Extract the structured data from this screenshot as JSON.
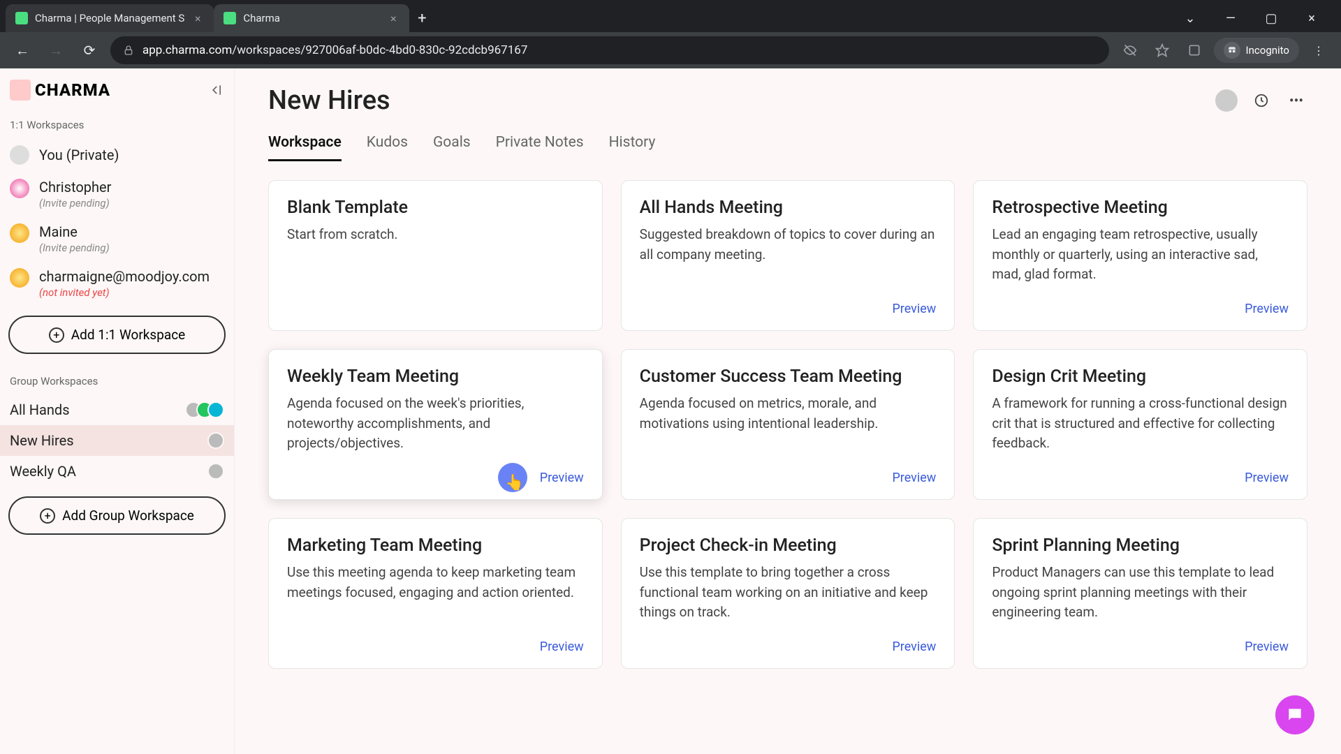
{
  "browser": {
    "tabs": [
      {
        "title": "Charma | People Management S"
      },
      {
        "title": "Charma"
      }
    ],
    "url_domain": "app.charma.com",
    "url_path": "/workspaces/927006af-b0dc-4bd0-830c-92cdcb967167",
    "incognito_label": "Incognito"
  },
  "logo_text": "CHARMA",
  "sidebar": {
    "section1_label": "1:1 Workspaces",
    "section2_label": "Group Workspaces",
    "add_11_label": "Add 1:1 Workspace",
    "add_group_label": "Add Group Workspace",
    "one_on_one": [
      {
        "title": "You (Private)",
        "sub": ""
      },
      {
        "title": "Christopher",
        "sub": "(Invite pending)"
      },
      {
        "title": "Maine",
        "sub": "(Invite pending)"
      },
      {
        "title": "charmaigne@moodjoy.com",
        "sub": "(not invited yet)"
      }
    ],
    "groups": [
      {
        "title": "All Hands"
      },
      {
        "title": "New Hires"
      },
      {
        "title": "Weekly QA"
      }
    ]
  },
  "page": {
    "title": "New Hires",
    "tabs": [
      "Workspace",
      "Kudos",
      "Goals",
      "Private Notes",
      "History"
    ],
    "preview_label": "Preview",
    "templates": [
      {
        "title": "Blank Template",
        "desc": "Start from scratch.",
        "preview": false
      },
      {
        "title": "All Hands Meeting",
        "desc": "Suggested breakdown of topics to cover during an all company meeting.",
        "preview": true
      },
      {
        "title": "Retrospective Meeting",
        "desc": "Lead an engaging team retrospective, usually monthly or quarterly, using an interactive sad, mad, glad format.",
        "preview": true
      },
      {
        "title": "Weekly Team Meeting",
        "desc": "Agenda focused on the week's priorities, noteworthy accomplishments, and projects/objectives.",
        "preview": true
      },
      {
        "title": "Customer Success Team Meeting",
        "desc": "Agenda focused on metrics, morale, and motivations using intentional leadership.",
        "preview": true
      },
      {
        "title": "Design Crit Meeting",
        "desc": "A framework for running a cross-functional design crit that is structured and effective for collecting feedback.",
        "preview": true
      },
      {
        "title": "Marketing Team Meeting",
        "desc": "Use this meeting agenda to keep marketing team meetings focused, engaging and action oriented.",
        "preview": true
      },
      {
        "title": "Project Check-in Meeting",
        "desc": "Use this template to bring together a cross functional team working on an initiative and keep things on track.",
        "preview": true
      },
      {
        "title": "Sprint Planning Meeting",
        "desc": "Product Managers can use this template to lead ongoing sprint planning meetings with their engineering team.",
        "preview": true
      }
    ]
  }
}
